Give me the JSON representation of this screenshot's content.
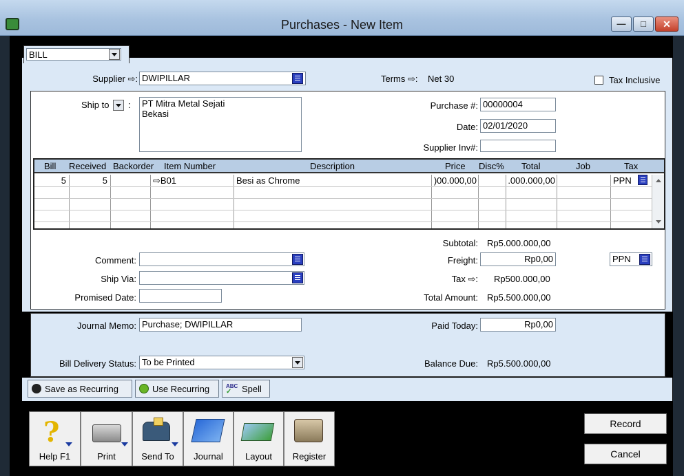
{
  "window": {
    "title": "Purchases - New Item"
  },
  "header": {
    "bill_type": "BILL",
    "supplier_label": "Supplier ⇨:",
    "supplier_value": "DWIPILLAR",
    "terms_label": "Terms ⇨:",
    "terms_value": "Net 30",
    "tax_inclusive_label": "Tax Inclusive"
  },
  "shipping": {
    "ship_to_label": "Ship to",
    "ship_to_colon": ":",
    "address_line1": "PT Mitra Metal Sejati",
    "address_line2": "Bekasi"
  },
  "purchase": {
    "number_label": "Purchase #:",
    "number_value": "00000004",
    "date_label": "Date:",
    "date_value": "02/01/2020",
    "supplier_inv_label": "Supplier Inv#:",
    "supplier_inv_value": ""
  },
  "table": {
    "headers": [
      "Bill",
      "Received",
      "Backorder",
      "Item Number",
      "Description",
      "Price",
      "Disc%",
      "Total",
      "Job",
      "Tax"
    ],
    "rows": [
      {
        "bill": "5",
        "received": "5",
        "backorder": "",
        "item": "⇨B01",
        "description": "Besi as Chrome",
        "price": ")00.000,00",
        "disc": "",
        "total": ".000.000,00",
        "job": "",
        "tax": "PPN"
      }
    ]
  },
  "summary": {
    "subtotal_label": "Subtotal:",
    "subtotal_value": "Rp5.000.000,00",
    "freight_label": "Freight:",
    "freight_value": "Rp0,00",
    "freight_tax": "PPN",
    "tax_label": "Tax ⇨:",
    "tax_value": "Rp500.000,00",
    "total_label": "Total Amount:",
    "total_value": "Rp5.500.000,00"
  },
  "details": {
    "comment_label": "Comment:",
    "comment_value": "",
    "ship_via_label": "Ship Via:",
    "ship_via_value": "",
    "promised_label": "Promised Date:",
    "promised_value": ""
  },
  "footer": {
    "memo_label": "Journal Memo:",
    "memo_value": "Purchase; DWIPILLAR",
    "paid_label": "Paid Today:",
    "paid_value": "Rp0,00",
    "delivery_label": "Bill Delivery Status:",
    "delivery_value": "To be Printed",
    "balance_label": "Balance Due:",
    "balance_value": "Rp5.500.000,00"
  },
  "actions": {
    "save_recurring": "Save as Recurring",
    "use_recurring": "Use Recurring",
    "spell": "Spell"
  },
  "toolbar": {
    "help": "Help F1",
    "print": "Print",
    "send_to": "Send To",
    "journal": "Journal",
    "layout": "Layout",
    "register": "Register"
  },
  "buttons": {
    "record": "Record",
    "cancel": "Cancel"
  },
  "colors": {
    "panel": "#dbe8f6",
    "title": "#a9c3e0",
    "lookup": "#2a3fbf"
  }
}
